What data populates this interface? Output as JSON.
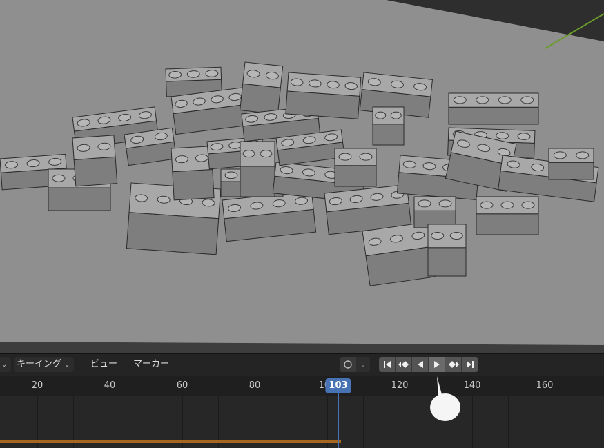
{
  "viewport": {
    "description_icon": "lego-brick-pile",
    "floor_color": "#8f8f8f",
    "brick_color": "#9a9a9a",
    "axis_color_y": "#6a9a2a"
  },
  "header": {
    "keying_label": "キーイング",
    "view_label": "ビュー",
    "marker_label": "マーカー",
    "auto_key_icon": "record-circle-icon",
    "playback_buttons": [
      {
        "name": "jump-to-start-icon",
        "glyph": "⏮"
      },
      {
        "name": "jump-to-prev-keyframe-icon",
        "glyph": "◆"
      },
      {
        "name": "play-reverse-icon",
        "glyph": "◀"
      },
      {
        "name": "play-icon",
        "glyph": "▶"
      },
      {
        "name": "jump-to-next-keyframe-icon",
        "glyph": "◆"
      },
      {
        "name": "jump-to-end-icon",
        "glyph": "⏭"
      }
    ]
  },
  "ruler": {
    "ticks": [
      "20",
      "40",
      "60",
      "80",
      "100",
      "120",
      "140",
      "160"
    ],
    "current_frame": "103"
  },
  "colors": {
    "accent": "#4772b3",
    "range": "#a8671f"
  }
}
